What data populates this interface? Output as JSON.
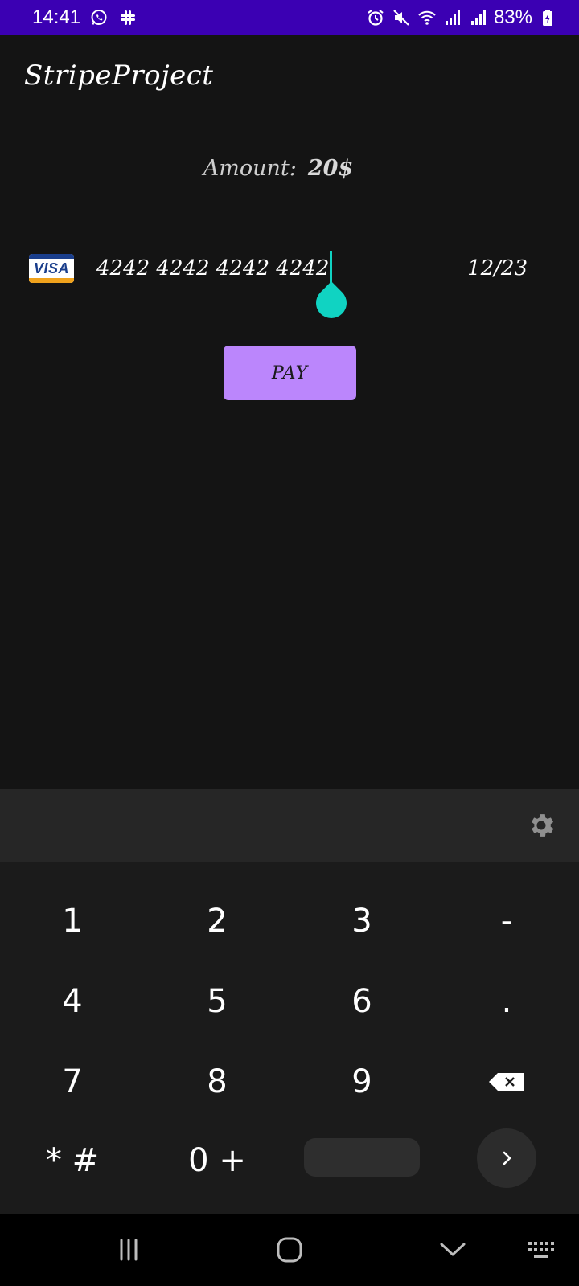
{
  "status_bar": {
    "time": "14:41",
    "battery": "83%",
    "left_icons": [
      "whatsapp-icon",
      "slack-icon"
    ],
    "right_icons": [
      "alarm-icon",
      "mute-icon",
      "wifi-icon",
      "signal-icon",
      "signal-icon",
      "battery-charging-icon"
    ]
  },
  "app": {
    "title": "StripeProject"
  },
  "amount": {
    "label": "Amount:",
    "value": "20$"
  },
  "card_input": {
    "brand": "VISA",
    "number": "4242 4242 4242 4242",
    "expiry": "12/23",
    "cursor_color": "#10d3c2"
  },
  "pay_button": {
    "label": "PAY",
    "color": "#bb86fc"
  },
  "keyboard": {
    "keys": {
      "k1": "1",
      "k2": "2",
      "k3": "3",
      "dash": "-",
      "k4": "4",
      "k5": "5",
      "k6": "6",
      "dot": ".",
      "k7": "7",
      "k8": "8",
      "k9": "9",
      "star_hash": "* #",
      "zero_plus": "0 +"
    }
  },
  "colors": {
    "status_bar": "#3b00b3",
    "background": "#141414",
    "keyboard": "#1b1b1b"
  }
}
